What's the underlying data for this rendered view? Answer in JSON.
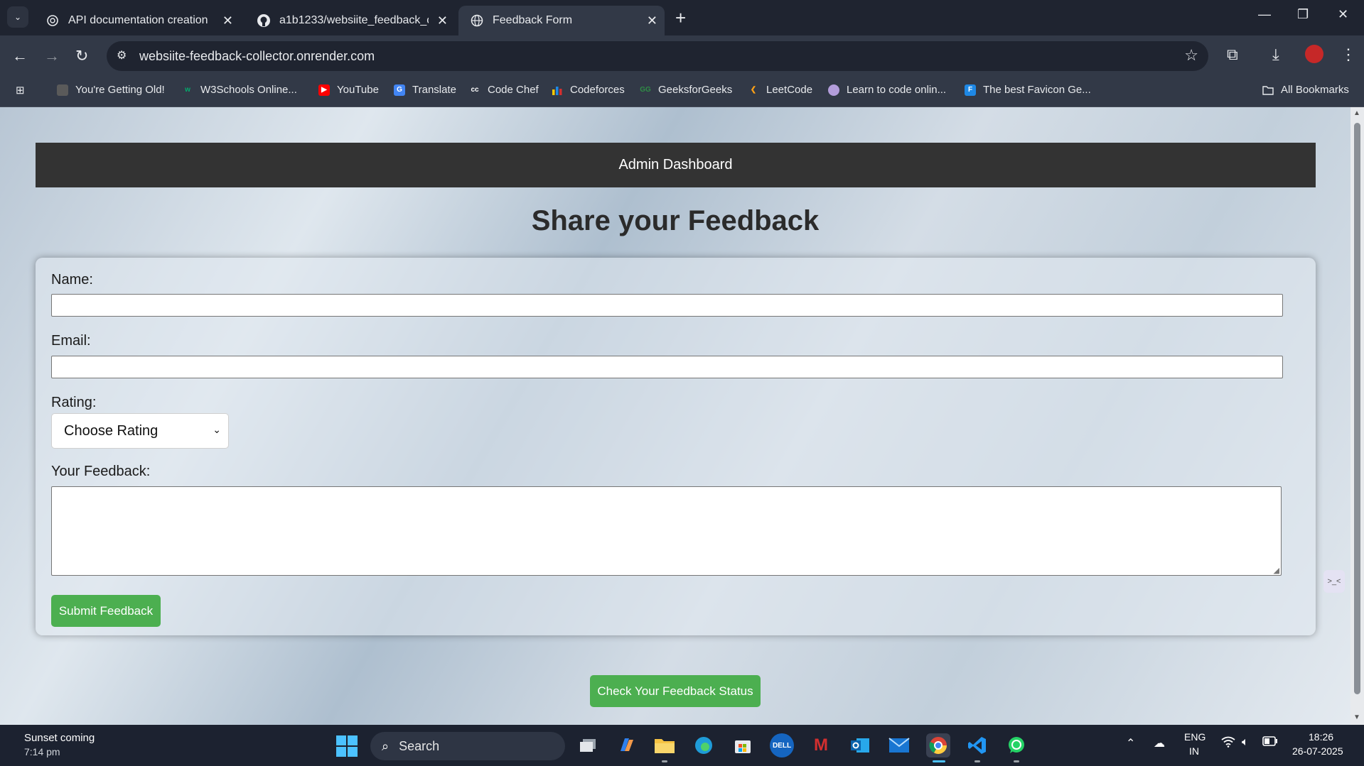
{
  "browser": {
    "tabs": [
      {
        "title": "API documentation creation",
        "icon": "openai-icon",
        "active": false
      },
      {
        "title": "a1b1233/websiite_feedback_co",
        "icon": "github-icon",
        "active": false
      },
      {
        "title": "Feedback Form",
        "icon": "globe-icon",
        "active": true
      }
    ],
    "url": "websiite-feedback-collector.onrender.com",
    "bookmarks": [
      {
        "label": "You're Getting Old!",
        "icon": "old-icon"
      },
      {
        "label": "W3Schools Online...",
        "icon": "w3schools-icon"
      },
      {
        "label": "YouTube",
        "icon": "youtube-icon"
      },
      {
        "label": "Translate",
        "icon": "translate-icon"
      },
      {
        "label": "Code Chef",
        "icon": "codechef-icon"
      },
      {
        "label": "Codeforces",
        "icon": "codeforces-icon"
      },
      {
        "label": "GeeksforGeeks",
        "icon": "geeksforgeeks-icon"
      },
      {
        "label": "LeetCode",
        "icon": "leetcode-icon"
      },
      {
        "label": "Learn to code onlin...",
        "icon": "learn-code-icon"
      },
      {
        "label": "The best Favicon Ge...",
        "icon": "favicon-generator-icon"
      }
    ],
    "all_bookmarks": "All Bookmarks"
  },
  "page": {
    "admin_bar": "Admin Dashboard",
    "heading": "Share your Feedback",
    "form": {
      "name_label": "Name:",
      "name_value": "",
      "email_label": "Email:",
      "email_value": "",
      "rating_label": "Rating:",
      "rating_selected": "Choose Rating",
      "feedback_label": "Your Feedback:",
      "feedback_value": "",
      "submit_label": "Submit Feedback"
    },
    "status_button": "Check Your Feedback Status"
  },
  "taskbar": {
    "weather_line1": "Sunset coming",
    "weather_line2": "7:14 pm",
    "search": "Search",
    "lang_line1": "ENG",
    "lang_line2": "IN",
    "time": "18:26",
    "date": "26-07-2025"
  },
  "colors": {
    "accent_green": "#4caf50",
    "admin_bar_bg": "#333333",
    "chrome_dark": "#1f2430"
  }
}
